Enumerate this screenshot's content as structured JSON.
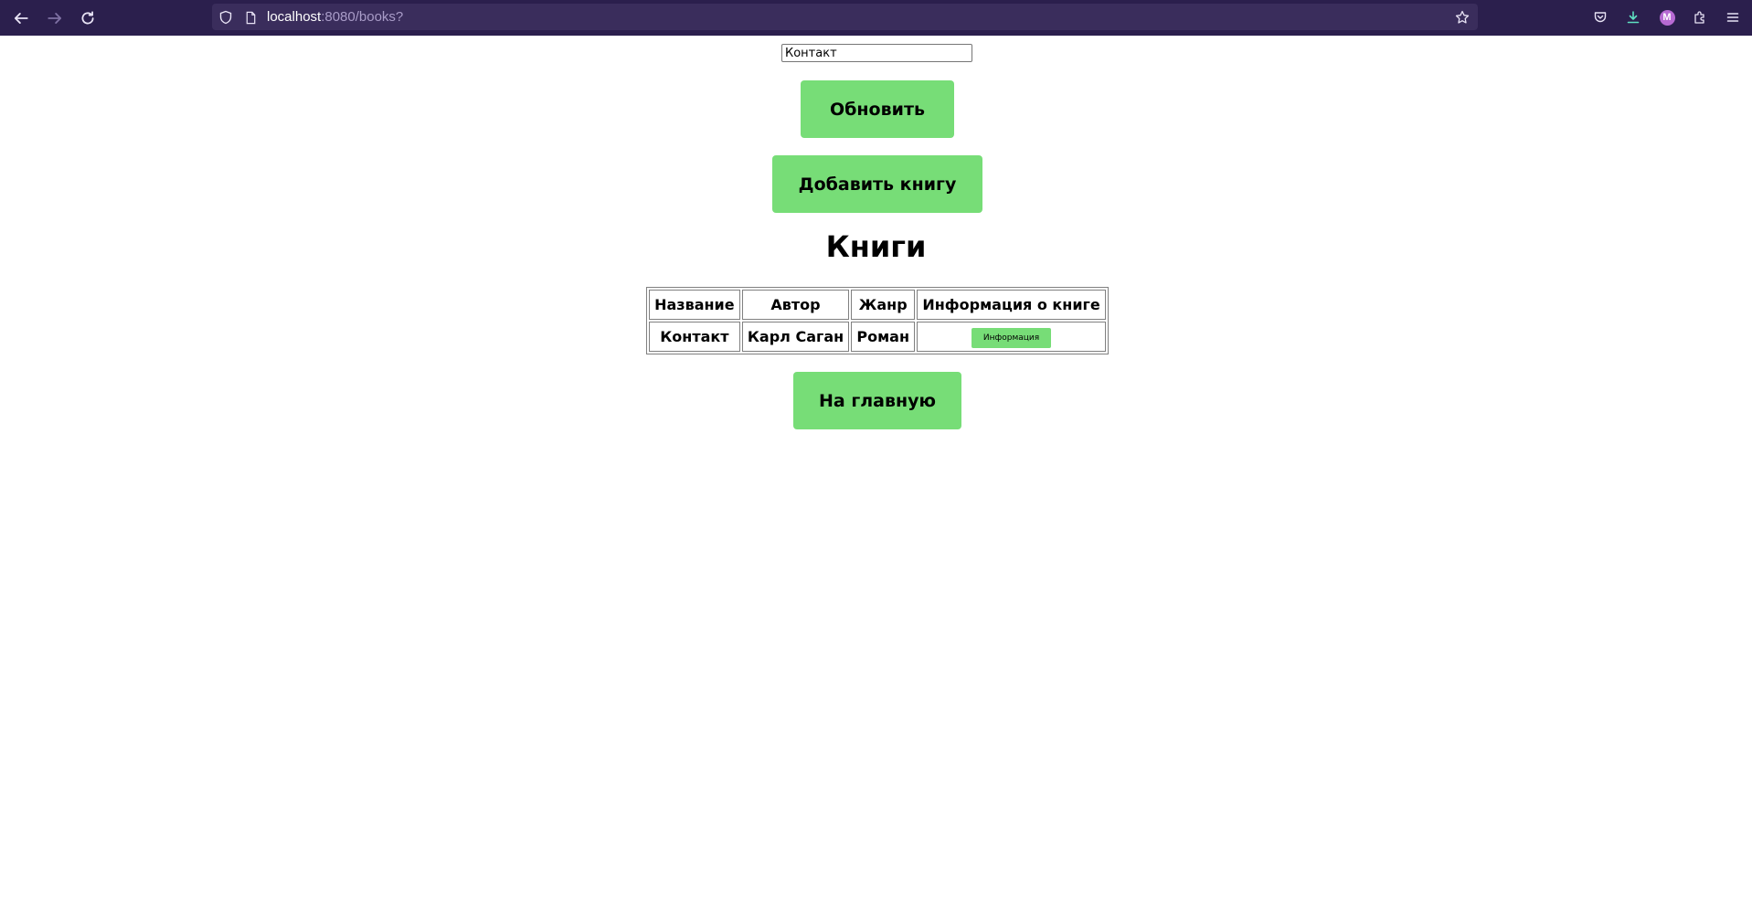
{
  "browser": {
    "url_host": "localhost",
    "url_path": ":8080/books?",
    "profile_initial": "M"
  },
  "search": {
    "value": "Контакт"
  },
  "buttons": {
    "refresh": "Обновить",
    "add_book": "Добавить книгу",
    "home": "На главную"
  },
  "title": "Книги",
  "table": {
    "headers": [
      "Название",
      "Автор",
      "Жанр",
      "Информация о книге"
    ],
    "rows": [
      {
        "title": "Контакт",
        "author": "Карл Саган",
        "genre": "Роман",
        "info_label": "Информация"
      }
    ]
  },
  "colors": {
    "browser_bar": "#2b1f4d",
    "button_green": "#77dd77"
  }
}
